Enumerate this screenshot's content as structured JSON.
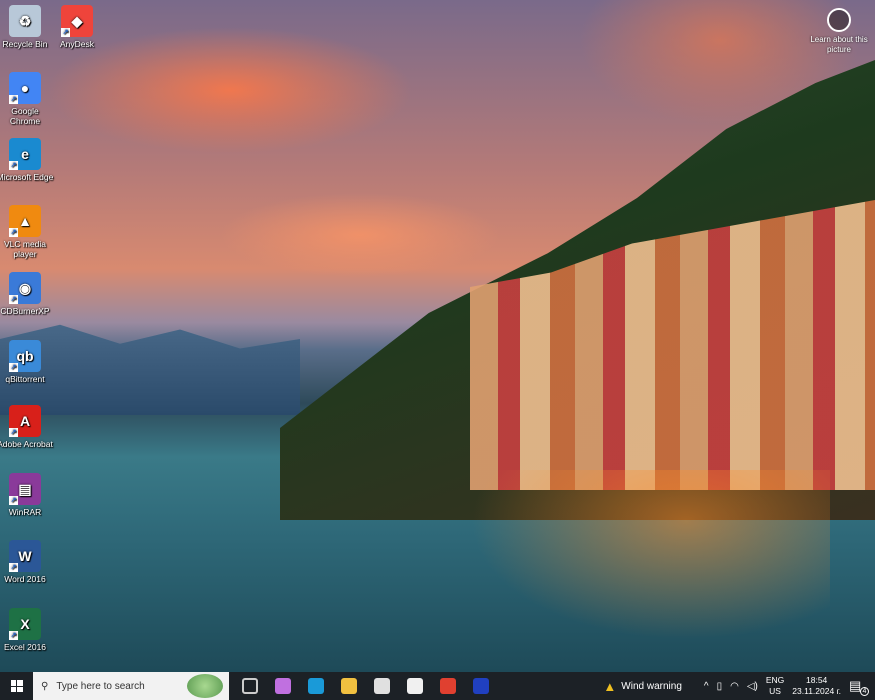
{
  "desktop": {
    "icons": [
      {
        "label": "Recycle Bin",
        "icon": "recycle-bin-icon",
        "color": "#b8c8d8",
        "glyph": "♻"
      },
      {
        "label": "AnyDesk",
        "icon": "anydesk-icon",
        "color": "#ef443b",
        "glyph": "◆"
      },
      {
        "label": "Google Chrome",
        "icon": "chrome-icon",
        "color": "#4285f4",
        "glyph": "●"
      },
      {
        "label": "Microsoft Edge",
        "icon": "edge-icon",
        "color": "#1a8ad0",
        "glyph": "e"
      },
      {
        "label": "VLC media player",
        "icon": "vlc-icon",
        "color": "#f08a10",
        "glyph": "▲"
      },
      {
        "label": "CDBurnerXP",
        "icon": "cdburnerxp-icon",
        "color": "#3a7ad8",
        "glyph": "◉"
      },
      {
        "label": "qBittorrent",
        "icon": "qbittorrent-icon",
        "color": "#3a8ad8",
        "glyph": "qb"
      },
      {
        "label": "Adobe Acrobat",
        "icon": "acrobat-icon",
        "color": "#d8201a",
        "glyph": "A"
      },
      {
        "label": "WinRAR",
        "icon": "winrar-icon",
        "color": "#8a3a9a",
        "glyph": "▤"
      },
      {
        "label": "Word 2016",
        "icon": "word-icon",
        "color": "#2b5797",
        "glyph": "W"
      },
      {
        "label": "Excel 2016",
        "icon": "excel-icon",
        "color": "#1e7145",
        "glyph": "X"
      }
    ],
    "learn_about": "Learn about this picture"
  },
  "taskbar": {
    "search_placeholder": "Type here to search",
    "pinned": [
      {
        "name": "task-view",
        "color": "#1c2126"
      },
      {
        "name": "copilot",
        "color": "#c070e0"
      },
      {
        "name": "edge",
        "color": "#1a9ad8"
      },
      {
        "name": "file-explorer",
        "color": "#f0c040"
      },
      {
        "name": "microsoft-store",
        "color": "#e0e0e0"
      },
      {
        "name": "mail",
        "color": "#f0f0f0"
      },
      {
        "name": "chrome",
        "color": "#e04030"
      },
      {
        "name": "l-app",
        "color": "#2040c0"
      }
    ],
    "weather": "Wind warning",
    "language": "ENG",
    "region": "US",
    "time": "18:54",
    "date": "23.11.2024 г.",
    "notifications": "4"
  }
}
